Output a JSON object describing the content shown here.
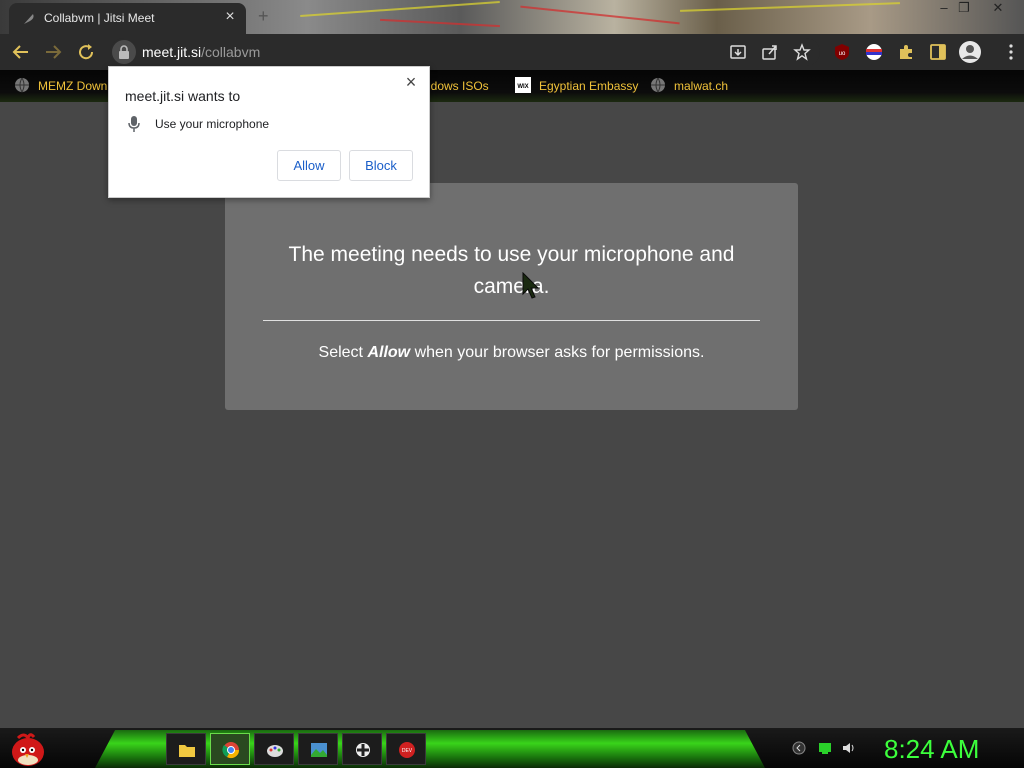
{
  "browser": {
    "tab_title": "Collabvm | Jitsi Meet",
    "tab_close": "×",
    "new_tab": "+",
    "window_controls": {
      "minimize": "–",
      "maximize": "❐",
      "close": "✕"
    },
    "url_host": "meet.jit.si",
    "url_path": "/collabvm"
  },
  "bookmarks": [
    {
      "label": "MEMZ Down",
      "icon": "globe-icon"
    },
    {
      "label": "Windows ISOs",
      "icon": "globe-icon"
    },
    {
      "label": "Egyptian Embassy",
      "icon": "wix-icon"
    },
    {
      "label": "malwat.ch",
      "icon": "globe-icon"
    }
  ],
  "permission_popup": {
    "heading": "meet.jit.si wants to",
    "permission": "Use your microphone",
    "allow_label": "Allow",
    "block_label": "Block",
    "close": "×"
  },
  "page": {
    "title": "The meeting needs to use your microphone and camera.",
    "subtitle_prefix": "Select ",
    "subtitle_emphasis": "Allow",
    "subtitle_suffix": " when your browser asks for permissions."
  },
  "taskbar": {
    "clock": "8:24 AM",
    "apps": [
      "explorer-icon",
      "chrome-icon",
      "paint-icon",
      "photo-icon",
      "gear-icon",
      "dev-icon"
    ]
  },
  "colors": {
    "page_bg": "#474747",
    "card_bg": "#6f6f6f",
    "bookmark_text": "#f0c23a",
    "clock": "#3cff3c",
    "button_text": "#1a5ec9"
  }
}
